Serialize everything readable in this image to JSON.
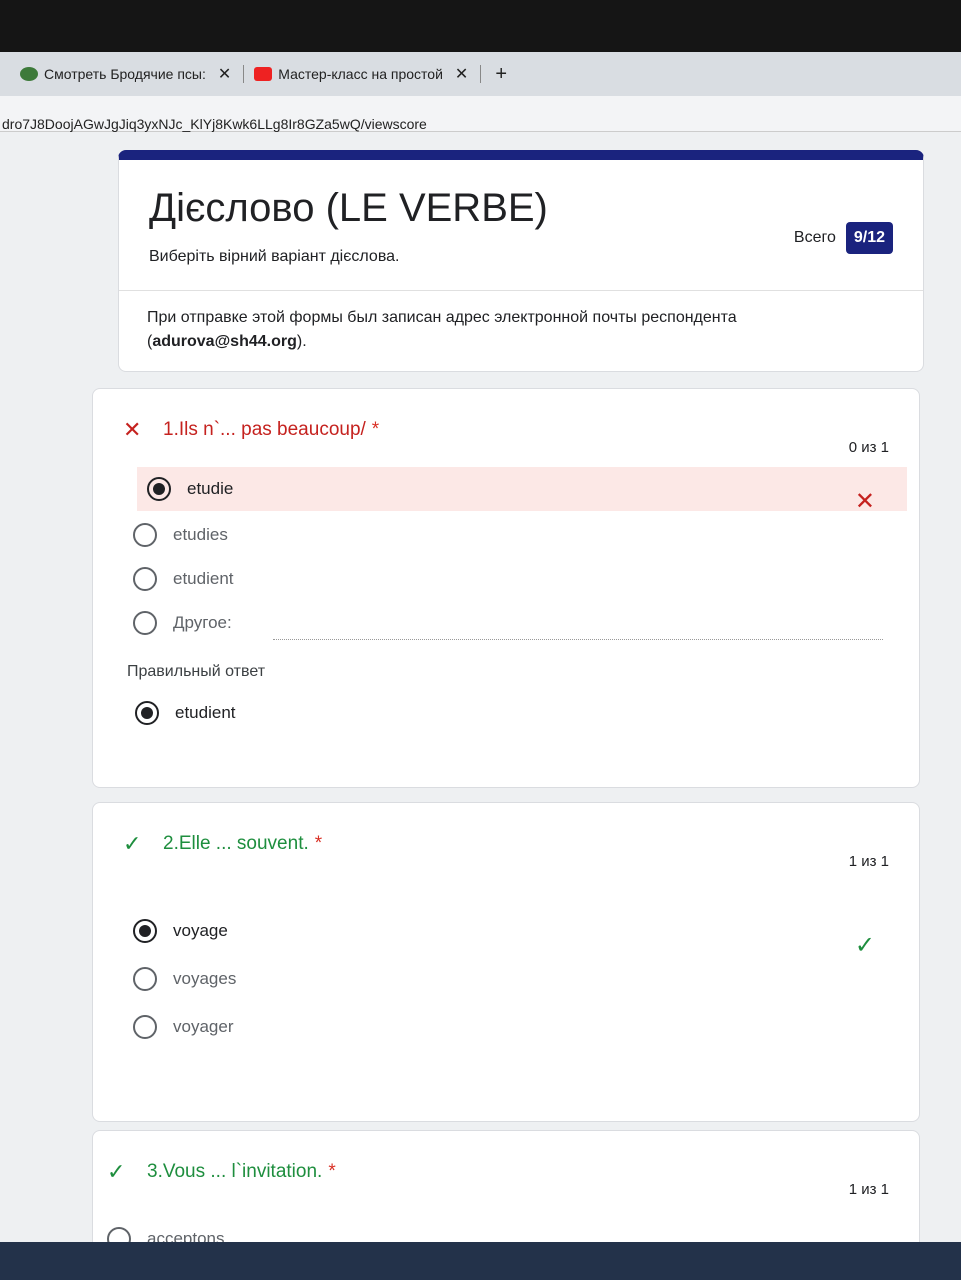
{
  "browser": {
    "tabs": [
      {
        "label": "Смотреть Бродячие псы: ",
        "close": "✕"
      },
      {
        "label": "Мастер-класс на простой",
        "close": "✕"
      }
    ],
    "new_tab": "+",
    "url": "dro7J8DoojAGwJgJiq3yxNJc_KlYj8Kwk6LLg8Ir8GZa5wQ/viewscore"
  },
  "form": {
    "title": "Дієслово (LE VERBE)",
    "subtitle": "Виберіть вірний варіант дієслова.",
    "total_label": "Всего",
    "total_score": "9/12",
    "email_note_prefix": "При отправке этой формы был записан адрес электронной почты респондента (",
    "email": "adurova@sh44.org",
    "email_note_suffix": ")."
  },
  "questions": [
    {
      "text": "1.Ils n`... pas beaucoup/",
      "required": "*",
      "score": "0 из 1",
      "status": "wrong",
      "options": [
        "etudie",
        "etudies",
        "etudient",
        "Другое:"
      ],
      "selected": "etudie",
      "correct_label": "Правильный ответ",
      "correct_answer": "etudient"
    },
    {
      "text": "2.Elle ... souvent.",
      "required": "*",
      "score": "1 из 1",
      "status": "correct",
      "options": [
        "voyage",
        "voyages",
        "voyager"
      ],
      "selected": "voyage"
    },
    {
      "text": "3.Vous ... l`invitation.",
      "required": "*",
      "score": "1 из 1",
      "status": "correct",
      "options": [
        "acceptons"
      ]
    }
  ],
  "colors": {
    "brand": "#1a237e",
    "wrong": "#c5221f",
    "correct": "#1e8e3e"
  }
}
